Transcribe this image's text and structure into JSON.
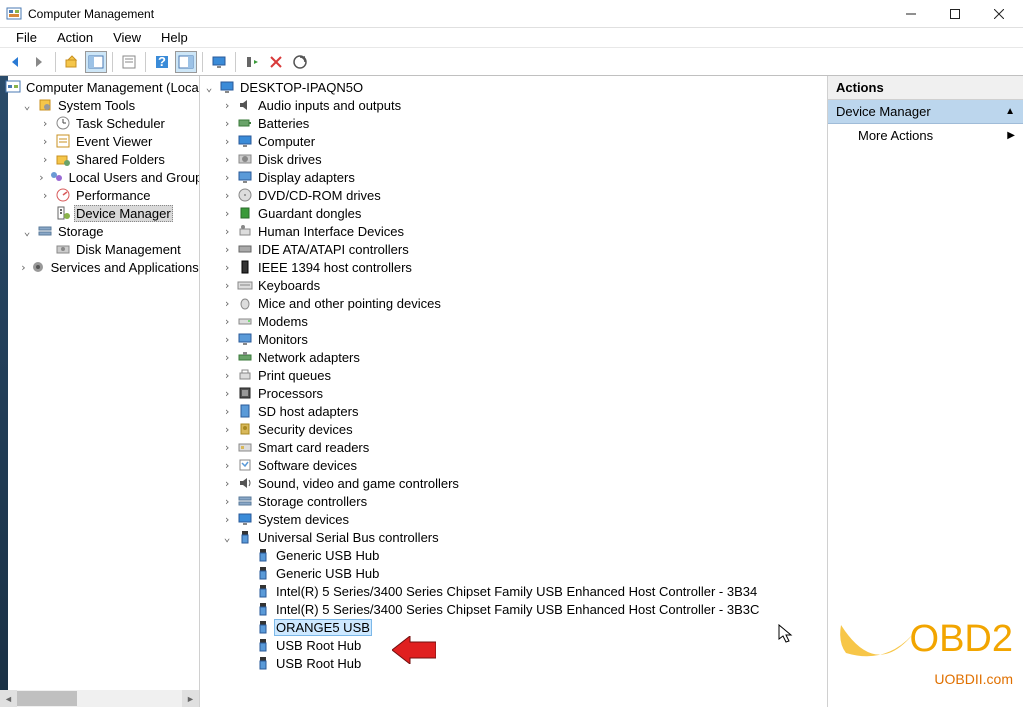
{
  "window": {
    "title": "Computer Management"
  },
  "menubar": [
    "File",
    "Action",
    "View",
    "Help"
  ],
  "leftTree": [
    {
      "indent": 0,
      "exp": "",
      "label": "Computer Management (Local",
      "sel": false
    },
    {
      "indent": 1,
      "exp": "v",
      "label": "System Tools",
      "sel": false
    },
    {
      "indent": 2,
      "exp": ">",
      "label": "Task Scheduler",
      "sel": false
    },
    {
      "indent": 2,
      "exp": ">",
      "label": "Event Viewer",
      "sel": false
    },
    {
      "indent": 2,
      "exp": ">",
      "label": "Shared Folders",
      "sel": false
    },
    {
      "indent": 2,
      "exp": ">",
      "label": "Local Users and Groups",
      "sel": false
    },
    {
      "indent": 2,
      "exp": ">",
      "label": "Performance",
      "sel": false
    },
    {
      "indent": 2,
      "exp": "",
      "label": "Device Manager",
      "sel": true
    },
    {
      "indent": 1,
      "exp": "v",
      "label": "Storage",
      "sel": false
    },
    {
      "indent": 2,
      "exp": "",
      "label": "Disk Management",
      "sel": false
    },
    {
      "indent": 1,
      "exp": ">",
      "label": "Services and Applications",
      "sel": false
    }
  ],
  "deviceTree": [
    {
      "indent": 0,
      "exp": "v",
      "label": "DESKTOP-IPAQN5O"
    },
    {
      "indent": 1,
      "exp": ">",
      "label": "Audio inputs and outputs"
    },
    {
      "indent": 1,
      "exp": ">",
      "label": "Batteries"
    },
    {
      "indent": 1,
      "exp": ">",
      "label": "Computer"
    },
    {
      "indent": 1,
      "exp": ">",
      "label": "Disk drives"
    },
    {
      "indent": 1,
      "exp": ">",
      "label": "Display adapters"
    },
    {
      "indent": 1,
      "exp": ">",
      "label": "DVD/CD-ROM drives"
    },
    {
      "indent": 1,
      "exp": ">",
      "label": "Guardant dongles"
    },
    {
      "indent": 1,
      "exp": ">",
      "label": "Human Interface Devices"
    },
    {
      "indent": 1,
      "exp": ">",
      "label": "IDE ATA/ATAPI controllers"
    },
    {
      "indent": 1,
      "exp": ">",
      "label": "IEEE 1394 host controllers"
    },
    {
      "indent": 1,
      "exp": ">",
      "label": "Keyboards"
    },
    {
      "indent": 1,
      "exp": ">",
      "label": "Mice and other pointing devices"
    },
    {
      "indent": 1,
      "exp": ">",
      "label": "Modems"
    },
    {
      "indent": 1,
      "exp": ">",
      "label": "Monitors"
    },
    {
      "indent": 1,
      "exp": ">",
      "label": "Network adapters"
    },
    {
      "indent": 1,
      "exp": ">",
      "label": "Print queues"
    },
    {
      "indent": 1,
      "exp": ">",
      "label": "Processors"
    },
    {
      "indent": 1,
      "exp": ">",
      "label": "SD host adapters"
    },
    {
      "indent": 1,
      "exp": ">",
      "label": "Security devices"
    },
    {
      "indent": 1,
      "exp": ">",
      "label": "Smart card readers"
    },
    {
      "indent": 1,
      "exp": ">",
      "label": "Software devices"
    },
    {
      "indent": 1,
      "exp": ">",
      "label": "Sound, video and game controllers"
    },
    {
      "indent": 1,
      "exp": ">",
      "label": "Storage controllers"
    },
    {
      "indent": 1,
      "exp": ">",
      "label": "System devices"
    },
    {
      "indent": 1,
      "exp": "v",
      "label": "Universal Serial Bus controllers"
    },
    {
      "indent": 2,
      "exp": "",
      "label": "Generic USB Hub"
    },
    {
      "indent": 2,
      "exp": "",
      "label": "Generic USB Hub"
    },
    {
      "indent": 2,
      "exp": "",
      "label": "Intel(R) 5 Series/3400 Series Chipset Family USB Enhanced Host Controller - 3B34"
    },
    {
      "indent": 2,
      "exp": "",
      "label": "Intel(R) 5 Series/3400 Series Chipset Family USB Enhanced Host Controller - 3B3C"
    },
    {
      "indent": 2,
      "exp": "",
      "label": "ORANGE5 USB",
      "selblue": true
    },
    {
      "indent": 2,
      "exp": "",
      "label": "USB Root Hub"
    },
    {
      "indent": 2,
      "exp": "",
      "label": "USB Root Hub"
    }
  ],
  "actions": {
    "header": "Actions",
    "group": "Device Manager",
    "item": "More Actions"
  },
  "watermark": {
    "big": "OBD2",
    "small": "UOBDII.com"
  }
}
